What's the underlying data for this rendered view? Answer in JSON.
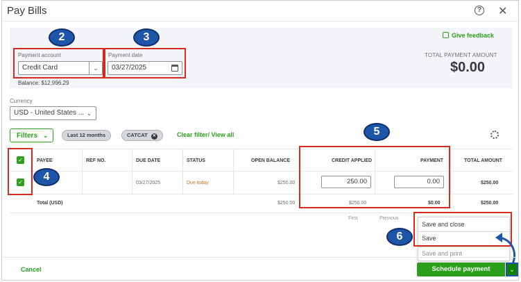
{
  "dialog": {
    "title": "Pay Bills",
    "help": "?",
    "close": "✕"
  },
  "top": {
    "payment_account_label": "Payment account",
    "payment_account_value": "Credit Card",
    "balance": "Balance: $12,996.29",
    "payment_date_label": "Payment date",
    "payment_date_value": "03/27/2025",
    "give_feedback": "Give feedback",
    "total_payment_label": "TOTAL PAYMENT AMOUNT",
    "total_payment_value": "$0.00"
  },
  "currency": {
    "label": "Currency",
    "value": "USD - United States ..."
  },
  "filters": {
    "button": "Filters",
    "chips": [
      "Last 12 months",
      "CATCAT"
    ],
    "clear": "Clear filter/ View all"
  },
  "table": {
    "headers": {
      "payee": "PAYEE",
      "ref": "REF NO.",
      "due": "DUE DATE",
      "status": "STATUS",
      "open": "OPEN BALANCE",
      "credit": "CREDIT APPLIED",
      "payment": "PAYMENT",
      "total": "TOTAL AMOUNT"
    },
    "row": {
      "due": "03/27/2025",
      "status": "Due today",
      "open": "$250.00",
      "credit": "250.00",
      "payment": "0.00",
      "total": "$250.00"
    },
    "totals": {
      "label": "Total (USD)",
      "open": "$250.00",
      "credit": "$250.00",
      "payment": "$0.00",
      "total": "$250.00"
    }
  },
  "pagination": {
    "first": "First",
    "previous": "Previous"
  },
  "menu": {
    "items": [
      "Save and close",
      "Save",
      "Save and print"
    ]
  },
  "footer": {
    "cancel": "Cancel",
    "schedule": "Schedule payment"
  },
  "annotations": [
    "2",
    "3",
    "4",
    "5",
    "6"
  ],
  "colors": {
    "accent_green": "#2ca01c",
    "highlight_red": "#d52b1e",
    "badge_blue": "#1f55a8",
    "due_orange": "#d4701a"
  }
}
